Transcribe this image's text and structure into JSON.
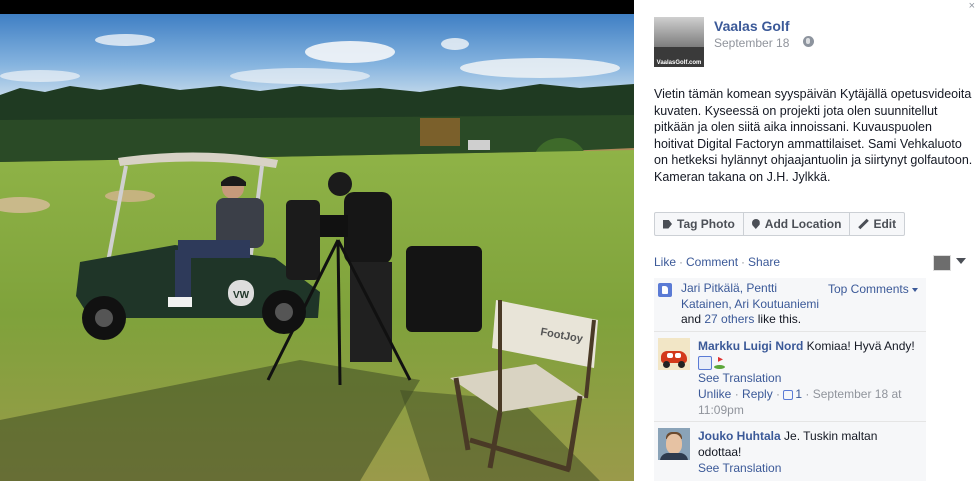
{
  "post": {
    "page_name": "Vaalas Golf",
    "date": "September 18",
    "thumb_text": "VaalasGolf.com",
    "caption": "Vietin tämän komean syyspäivän Kytäjällä opetusvideoita kuvaten. Kyseessä on projekti jota olen suunnitellut pitkään ja olen siitä aika innoissani. Kuvauspuolen hoitivat Digital Factoryn ammattilaiset. Sami Vehkaluoto on hetkeksi hylännyt ohjaajantuolin ja siirtynyt golfautoon. Kameran takana on J.H. Jylkkä."
  },
  "close": "×",
  "photo": {
    "chair_brand": "FootJoy",
    "cart_badge": "VW"
  },
  "actions": {
    "tag_photo": "Tag Photo",
    "add_location": "Add Location",
    "edit": "Edit"
  },
  "ufi": {
    "like": "Like",
    "comment": "Comment",
    "share": "Share",
    "sep": "·"
  },
  "likes": {
    "names": "Jari Pitkälä, Pentti Katainen, Ari Koutuaniemi",
    "and": " and ",
    "others": "27 others",
    "suffix": " like this.",
    "top_comments": "Top Comments"
  },
  "comments": [
    {
      "author": "Markku Luigi Nord",
      "text": " Komiaa! Hyvä Andy!",
      "see_translation": "See Translation",
      "unlike": "Unlike",
      "reply": "Reply",
      "like_count": "1",
      "meta_date": "September 18 at 11:09pm",
      "sep": " · "
    },
    {
      "author": "Jouko Huhtala",
      "text": " Je. Tuskin maltan odottaa!",
      "see_translation": "See Translation"
    }
  ],
  "colors": {
    "link": "#3b5998",
    "meta": "#90949c",
    "panel_bg": "#ffffff",
    "ufi_bg": "#f6f7f9"
  }
}
